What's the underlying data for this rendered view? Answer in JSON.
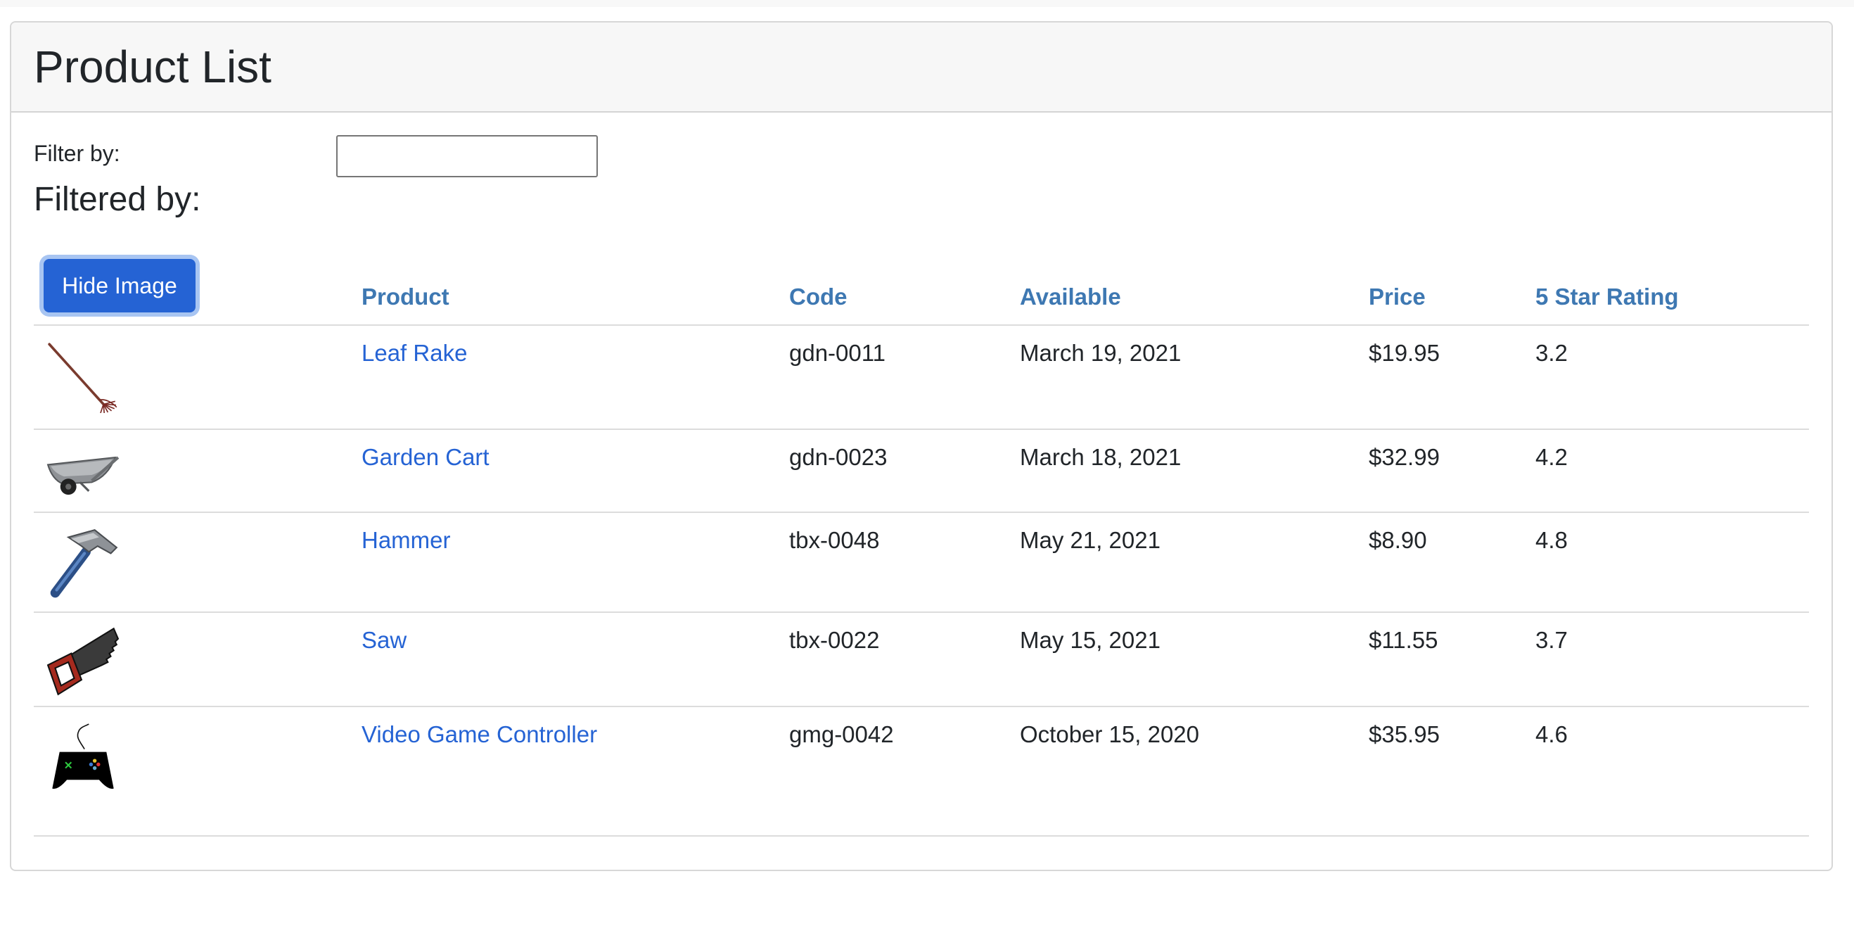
{
  "header": {
    "title": "Product List"
  },
  "filter": {
    "label": "Filter by:",
    "value": "",
    "filtered_by_label": "Filtered by:"
  },
  "toolbar": {
    "hide_image_label": "Hide Image"
  },
  "table": {
    "columns": [
      "Product",
      "Code",
      "Available",
      "Price",
      "5 Star Rating"
    ],
    "rows": [
      {
        "image_icon": "leaf-rake-icon",
        "name": "Leaf Rake",
        "code": "gdn-0011",
        "available": "March 19, 2021",
        "price": "$19.95",
        "rating": "3.2"
      },
      {
        "image_icon": "garden-cart-icon",
        "name": "Garden Cart",
        "code": "gdn-0023",
        "available": "March 18, 2021",
        "price": "$32.99",
        "rating": "4.2"
      },
      {
        "image_icon": "hammer-icon",
        "name": "Hammer",
        "code": "tbx-0048",
        "available": "May 21, 2021",
        "price": "$8.90",
        "rating": "4.8"
      },
      {
        "image_icon": "saw-icon",
        "name": "Saw",
        "code": "tbx-0022",
        "available": "May 15, 2021",
        "price": "$11.55",
        "rating": "3.7"
      },
      {
        "image_icon": "game-controller-icon",
        "name": "Video Game Controller",
        "code": "gmg-0042",
        "available": "October 15, 2020",
        "price": "$35.95",
        "rating": "4.6"
      }
    ]
  },
  "colors": {
    "link": "#2563d4",
    "header_text": "#3e78b2",
    "button_bg": "#2563d4",
    "button_ring": "#a8c5f2"
  }
}
